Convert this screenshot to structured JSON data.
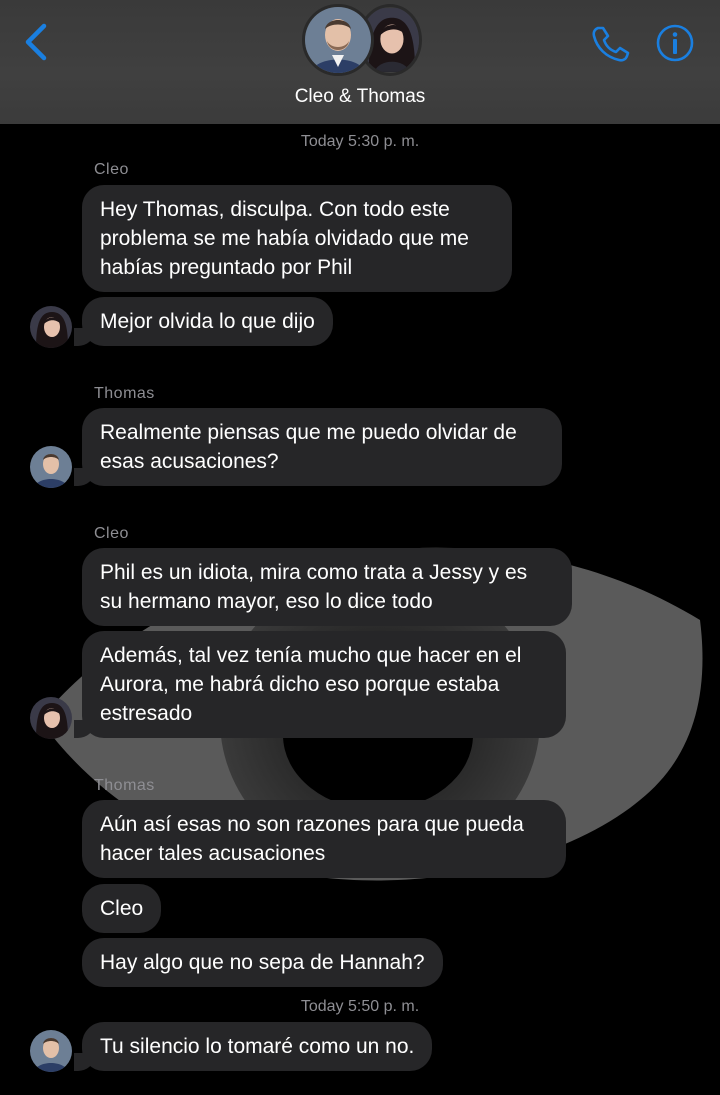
{
  "header": {
    "title": "Cleo & Thomas",
    "back_icon": "chevron-left-icon",
    "call_icon": "phone-icon",
    "info_icon": "info-icon",
    "accent": "#1a7fe0"
  },
  "conversation": {
    "timestamps": [
      "Today 5:30 p. m.",
      "Today 5:50 p. m."
    ],
    "senders": [
      "Cleo",
      "Thomas",
      "Cleo",
      "Thomas"
    ],
    "messages": [
      "Hey Thomas, disculpa. Con todo este problema se me había olvidado que me habías preguntado por Phil",
      "Mejor olvida lo que dijo",
      "Realmente piensas que me puedo olvidar de esas acusaciones?",
      "Phil es un idiota, mira como trata a Jessy y es su hermano mayor, eso lo dice todo",
      "Además, tal vez tenía mucho que hacer en el Aurora, me habrá dicho eso porque estaba estresado",
      "Aún así esas no son razones para que pueda hacer tales acusaciones",
      "Cleo",
      "Hay algo que no sepa de Hannah?",
      "Tu silencio lo tomaré como un no."
    ]
  },
  "colors": {
    "bubble": "#262628",
    "meta_text": "#8e8e93",
    "header_bg": "#404040"
  }
}
